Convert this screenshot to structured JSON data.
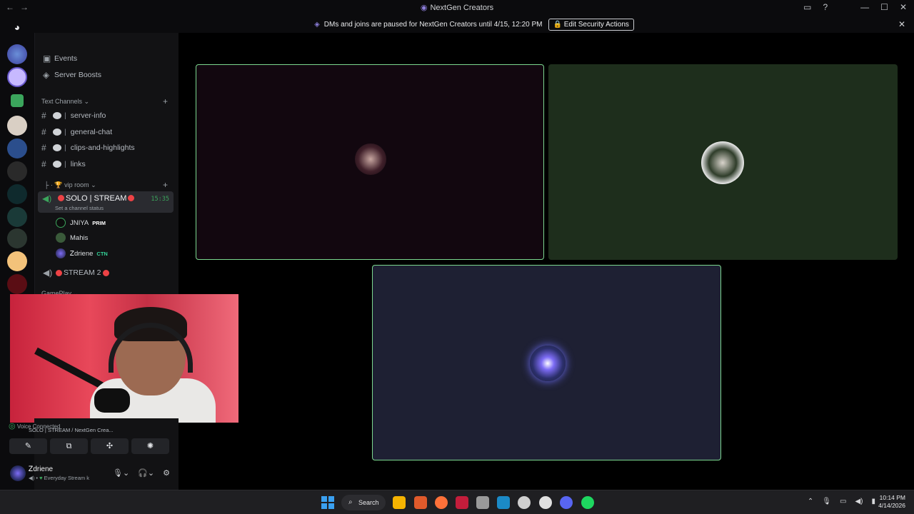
{
  "window": {
    "title": "NextGen Creators",
    "nav_back": "←",
    "nav_forward": "→",
    "controls": {
      "inbox": "▭",
      "help": "?",
      "minimize": "—",
      "maximize": "☐",
      "close": "✕"
    }
  },
  "banner": {
    "text": "DMs and joins are paused for NextGen Creators until 4/15, 12:20 PM",
    "button": "Edit Security Actions",
    "close": "✕"
  },
  "server": {
    "name": "NextGen Creators",
    "chevron": "⌄",
    "invite_icon": "person-add-icon"
  },
  "sidebar": {
    "top_items": [
      {
        "label": "Events"
      },
      {
        "label": "Server Boosts"
      }
    ],
    "text_category": "Text Channels",
    "text_channels": [
      {
        "label": "server-info"
      },
      {
        "label": "general-chat"
      },
      {
        "label": "clips-and-highlights"
      },
      {
        "label": "links"
      }
    ],
    "vip_category": "vip room",
    "active_voice": {
      "name": "SOLO | STREAM",
      "status": "Set a channel status",
      "time": "15:35"
    },
    "members": [
      {
        "name": "JNIYA",
        "tag": "PRIM",
        "tag_color": "#ffffff"
      },
      {
        "name": "Mahis",
        "tag": "",
        "tag_color": "#ffffff"
      },
      {
        "name": "Ꮓdriene",
        "tag": "CTN",
        "tag_color": "#34d399"
      }
    ],
    "second_voice": "STREAM 2",
    "gameplay_category": "GamePlay"
  },
  "voice_panel": {
    "connected": "Voice Connected",
    "sub": "SOLO | STREAM / NextGen Crea...",
    "buttons": [
      "✎",
      "⧉",
      "✣",
      "✺"
    ]
  },
  "user_panel": {
    "username": "Ꮓdriene",
    "status": "Everyday Stream k"
  },
  "taskbar": {
    "search": "Search",
    "time": "10:14 PM",
    "date": "4/14/2026",
    "app_colors": [
      "#f5b301",
      "#e05a2b",
      "#ff7139",
      "#c31d3b",
      "#9a9a9a",
      "#1b8ac7",
      "#cfcfcf",
      "#e0e0e0",
      "#5865f2",
      "#1ed760"
    ]
  },
  "colors": {
    "accent_green": "#3ba55c",
    "tile1_bg": "#12070f",
    "tile2_bg": "#1e2e1c",
    "tile3_bg": "#1e2033",
    "speaking_border": "#7bd88f"
  }
}
